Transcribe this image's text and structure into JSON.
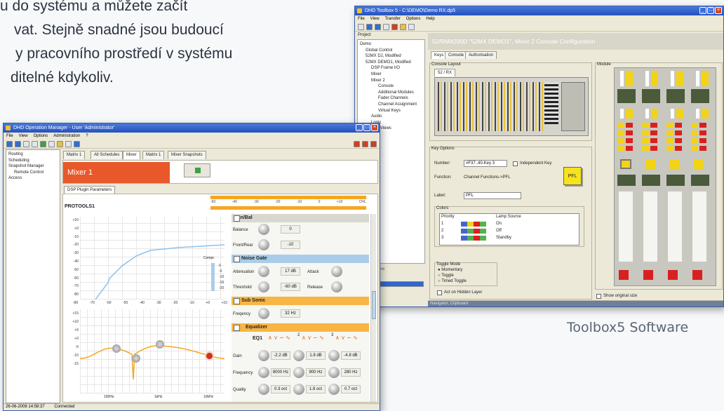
{
  "slide": {
    "lines": [
      "u do systému a můžete začít",
      "vat. Stejně snadné jsou budoucí",
      "y pracovního prostředí v systému",
      "ditelné kdykoliv."
    ],
    "caption": "Toolbox5 Software"
  },
  "toolbox": {
    "title": "DHD Toolbox 5 - C:\\DEMO\\Demo RX.dp5",
    "menu": [
      "File",
      "View",
      "Transfer",
      "Options",
      "Help"
    ],
    "project_label": "Project",
    "tree": [
      "Demo",
      "Global Control",
      "52MX DJ, Modified",
      "52MX DEMO1, Modified",
      "DSP Frame I/O",
      "Mixer",
      "Mixer 2",
      "Console",
      "Additional Modules",
      "Fader Channels",
      "Channel Assignment",
      "Virtual Keys",
      "Audio",
      "Logic",
      "PFT Views"
    ],
    "header": "52/RM4200D \"52MX DEMO1\", Mixer 2 Console Configuration",
    "tabs": [
      "Keys",
      "Console",
      "Authorisation"
    ],
    "console_layout_label": "Console Layout",
    "layout_tab": "52 / RX",
    "module_label": "Module",
    "key_options_label": "Key Options",
    "number_label": "Number:",
    "number_value": "#F37..40-Key 3",
    "independent_key": "Independent Key",
    "function_label": "Function:",
    "function_value": "Channel Functions->PFL",
    "label_label": "Label:",
    "label_value": "PFL",
    "pfl_key": "PFL",
    "colors_label": "Colors",
    "colors_headers": [
      "Priority",
      "Lamp Source"
    ],
    "colors_rows": [
      {
        "priority": "1",
        "source": "On"
      },
      {
        "priority": "2",
        "source": "Off"
      },
      {
        "priority": "3",
        "source": "Standby"
      }
    ],
    "toggle_mode_label": "Toggle Mode",
    "toggle_options": [
      "Momentary",
      "Toggle",
      "Timed Toggle"
    ],
    "act_hidden": "Act on Hidden Layer",
    "show_original": "Show original size",
    "remove_button": "Remove",
    "status": "Navigator, Clipboard"
  },
  "opman": {
    "title": "DHD Operation Manager - User 'Administrator'",
    "menu": [
      "File",
      "View",
      "Options",
      "Administration",
      "?"
    ],
    "tree": [
      "Routing",
      "Scheduling",
      "Snapshot Manager",
      "Remote Control",
      "Access"
    ],
    "tabs": [
      "Matrix 1",
      "All Schedules",
      "Mixer",
      "Matrix 1",
      "Mixer Snapshots"
    ],
    "mixer_title": "Mixer 1",
    "sub_tab": "DSP Plugin Parameters",
    "preset": "PROTOOLS1",
    "meter_scale": [
      "-60",
      "-40",
      "-30",
      "-20",
      "-10",
      "0",
      "+10",
      "OVL"
    ],
    "dyn_y": [
      "+10",
      "+0",
      "-10",
      "-20",
      "-30",
      "-40",
      "-50",
      "-60",
      "-70",
      "-80"
    ],
    "dyn_x": [
      "-80",
      "-70",
      "-60",
      "-50",
      "-40",
      "-30",
      "-20",
      "-10",
      "+0",
      "+10"
    ],
    "compr_label": "Compr.",
    "compr_scale": [
      "0",
      "-5",
      "-10",
      "-15",
      "-20"
    ],
    "eq_y": [
      "+15",
      "+10",
      "+5",
      "+0",
      "-5",
      "-10",
      "-15"
    ],
    "eq_x": [
      "100Hz",
      "1kHz",
      "10kHz"
    ],
    "pan_bal": "Pan/Bal",
    "balance_label": "Balance",
    "balance_value": "0",
    "front_rear_label": "Front/Rear",
    "front_rear_value": "-10",
    "noise_gate": "Noise Gate",
    "attenuation_label": "Attenuation",
    "attenuation_value": "17 dB",
    "attack_label": "Attack",
    "threshold_label": "Threshold",
    "threshold_value": "-60 dB",
    "release_label": "Release",
    "sub_sonic": "Sub Sonic",
    "frequency_label": "Freqency",
    "frequency_value": "32 Hz",
    "equalizer": "Equalizer",
    "eq1_label": "EQ1",
    "band_numbers": [
      "2",
      "3"
    ],
    "gain_label": "Gain",
    "gain_values": [
      "-2.2 dB",
      "1.8 dB",
      "-4.8 dB"
    ],
    "freq_label": "Frequency",
    "freq_values": [
      "8000 Hz",
      "900 Hz",
      "280 Hz"
    ],
    "quality_label": "Quality",
    "quality_values": [
      "0.3 oct",
      "1.8 oct",
      "0.7 oct"
    ],
    "status_time": "26-06-2008 14:58:37",
    "status_state": "Connected"
  },
  "colors": {
    "mixer_header": "#e8582a",
    "accent_orange": "#f5a623",
    "section_blue": "#a9cde9",
    "section_orange": "#f8b544",
    "xp_blue": "#2452c0"
  }
}
